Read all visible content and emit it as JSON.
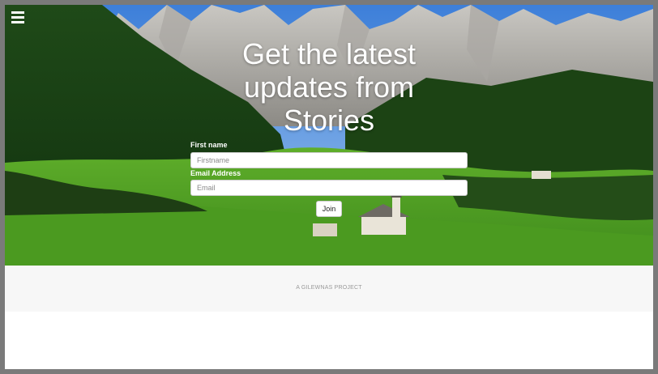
{
  "hero": {
    "headline": "Get the latest updates from Stories"
  },
  "form": {
    "first_name_label": "First name",
    "first_name_placeholder": "Firstname",
    "email_label": "Email Address",
    "email_placeholder": "Email",
    "join_label": "Join"
  },
  "footer": {
    "text": "A GILEWNAS PROJECT"
  },
  "icons": {
    "menu": "hamburger-menu-icon"
  },
  "colors": {
    "page_border": "#7a7a7a",
    "footer_bg": "#f7f7f7",
    "headline": "#ffffff"
  }
}
